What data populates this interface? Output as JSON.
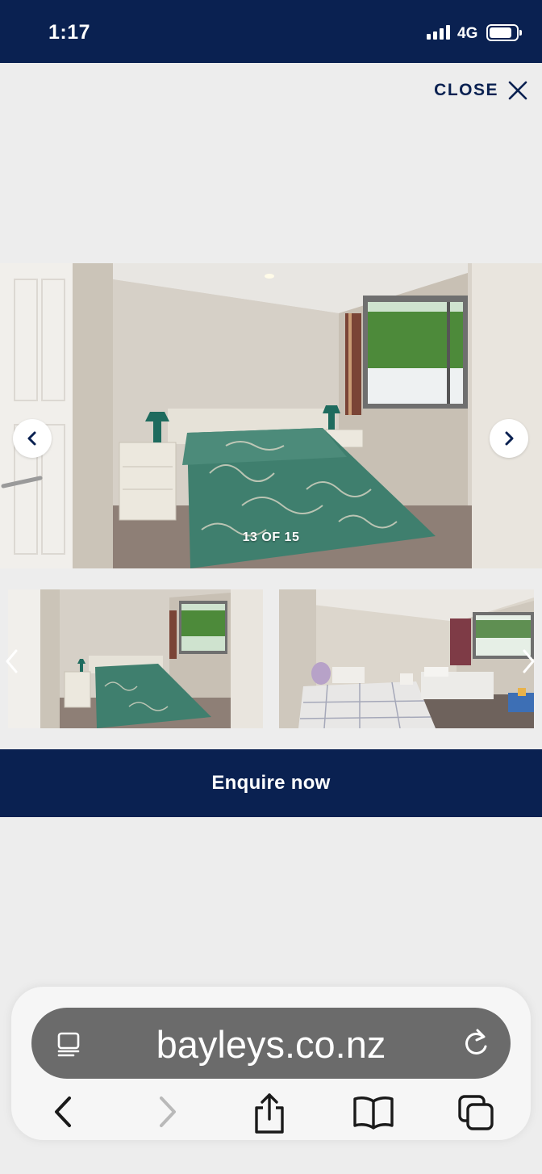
{
  "status_bar": {
    "time": "1:17",
    "network": "4G"
  },
  "gallery": {
    "close_label": "CLOSE",
    "counter": "13 OF 15",
    "enquire_label": "Enquire now"
  },
  "browser": {
    "url": "bayleys.co.nz"
  },
  "icons": {
    "close": "close-icon",
    "prev": "chevron-left-icon",
    "next": "chevron-right-icon",
    "reader": "reader-mode-icon",
    "reload": "reload-icon",
    "back": "back-arrow-icon",
    "forward": "forward-arrow-icon",
    "share": "share-icon",
    "bookmarks": "bookmarks-icon",
    "tabs": "tabs-icon"
  },
  "colors": {
    "brand_navy": "#0a2151",
    "background": "#ededed"
  }
}
